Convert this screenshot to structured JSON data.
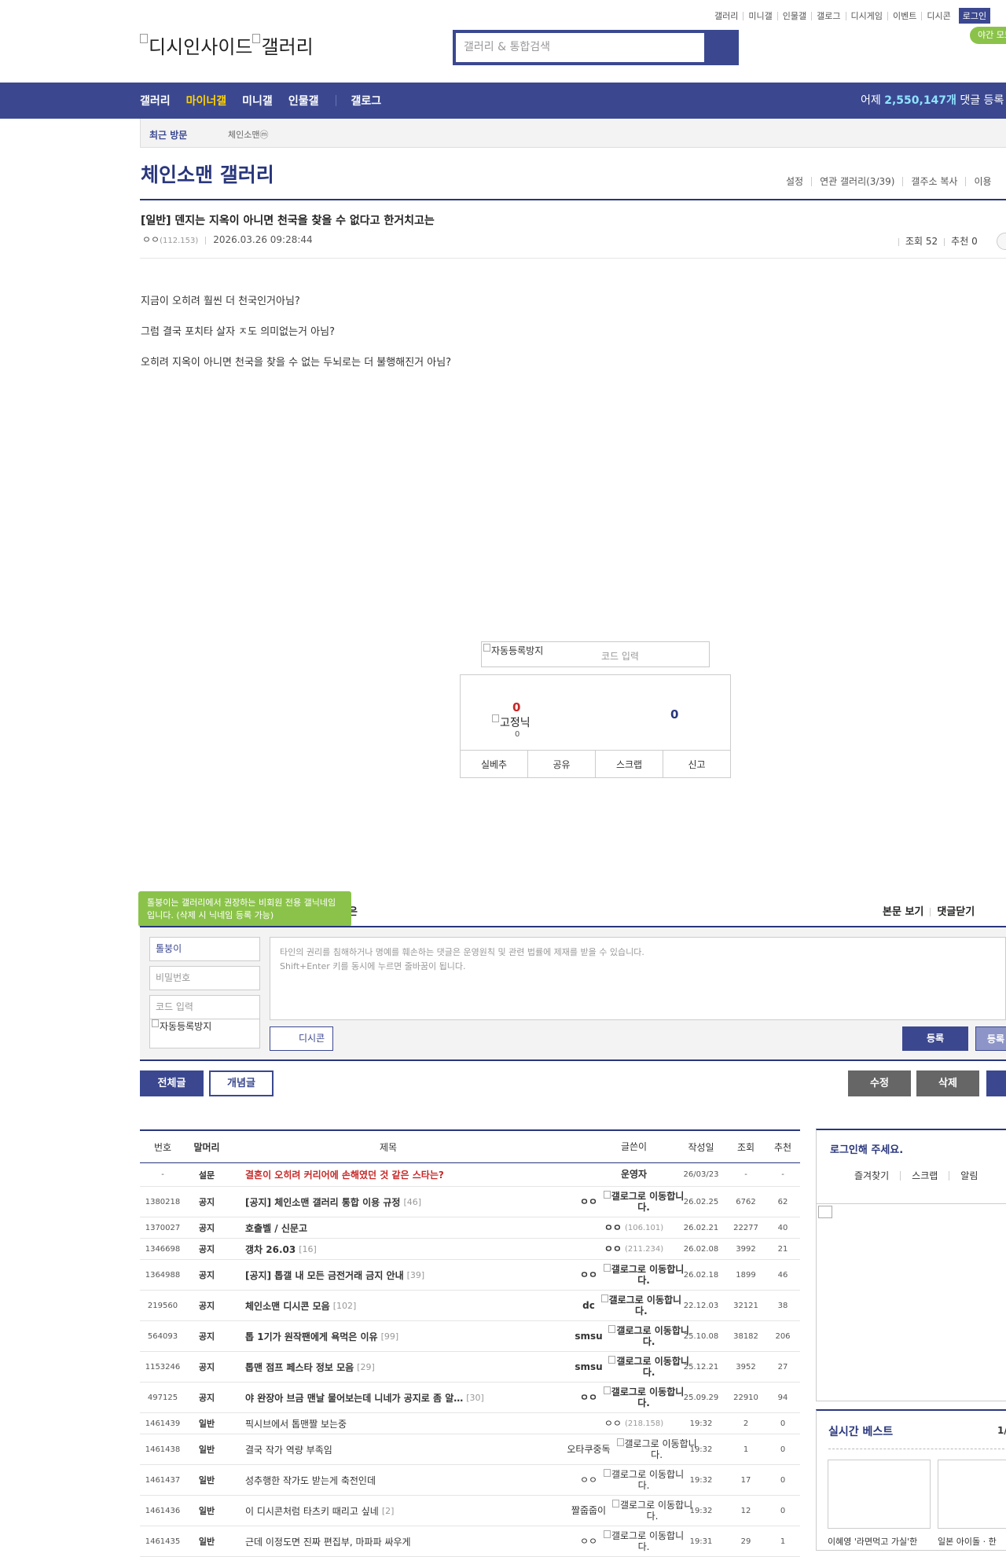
{
  "topnav": {
    "items": [
      "갤러리",
      "미니갤",
      "인물갤",
      "갤로그",
      "디시게임",
      "이벤트",
      "디시콘"
    ],
    "login": "로그인",
    "night": "야간 모드"
  },
  "logo": {
    "alt1": "디시인사이드",
    "alt2": "갤러리"
  },
  "search": {
    "placeholder": "갤러리 & 통합검색"
  },
  "nav": {
    "items": [
      "갤러리",
      "마이너갤",
      "미니갤",
      "인물갤"
    ],
    "gallog": "갤로그",
    "stat_prefix": "어제",
    "stat_value": "2,550,147개",
    "stat_suffix": "댓글 등록"
  },
  "recent": {
    "label": "최근 방문",
    "item": "체인소맨ⓜ"
  },
  "gallery": {
    "title": "체인소맨 갤러리",
    "menu": [
      "설정",
      "연관 갤러리(3/39)",
      "갤주소 복사",
      "이용"
    ]
  },
  "post": {
    "title": "[일반] 덴지는 지옥이 아니면 천국을 찾을 수 없다고 한거치고는",
    "author": "ㅇㅇ",
    "ip": "(112.153)",
    "date": "2026.03.26 09:28:44",
    "views": "조회 52",
    "recommend": "추천 0",
    "body": [
      "지금이 오히려 훨씬 더 천국인거아님?",
      "그럼 결국 포치타 살자 ㅈ도 의미없는거 아님?",
      "오히려 지옥이 아니면 천국을 찾을 수 없는 두뇌로는 더 불행해진거 아님?"
    ]
  },
  "captcha": {
    "img_alt": "자동등록방지",
    "placeholder": "코드 입력"
  },
  "vote": {
    "up": "0",
    "fixed_nick_alt": "고정닉",
    "fixed_count": "0",
    "down": "0",
    "buttons": [
      "실베추",
      "공유",
      "스크랩",
      "신고"
    ]
  },
  "comment": {
    "tooltip": "톨붕이는 갤러리에서 권장하는 비회원 전용 갤닉네임입니다. (삭제 시 닉네임 등록 가능)",
    "peek": "은",
    "options": [
      "본문 보기",
      "댓글닫기"
    ],
    "nick": "톨붕이",
    "password": "비밀번호",
    "code": "코드 입력",
    "captcha_alt": "자동등록방지",
    "placeholder1": "타인의 권리를 침해하거나 명예를 훼손하는 댓글은 운영원칙 및 관련 법률에 제재를 받을 수 있습니다.",
    "placeholder2": "Shift+Enter 키를 동시에 누르면 줄바꿈이 됩니다.",
    "dccon": "디시콘",
    "register": "등록",
    "register2": "등록"
  },
  "buttons": {
    "all": "전체글",
    "concept": "개념글",
    "edit": "수정",
    "delete": "삭제"
  },
  "list": {
    "headers": [
      "번호",
      "말머리",
      "제목",
      "글쓴이",
      "작성일",
      "조회",
      "추천"
    ],
    "rows": [
      {
        "no": "-",
        "head": "설문",
        "title": "결혼이 오히려 커리어에 손해였던 것 같은 스타는?",
        "count": "",
        "writer": "운영자",
        "ip": "",
        "img": "",
        "date": "26/03/23",
        "views": "-",
        "rec": "-",
        "type": "survey"
      },
      {
        "no": "1380218",
        "head": "공지",
        "title": "[공지] 체인소맨 갤러리 통합 이용 규정",
        "count": "[46]",
        "writer": "ㅇㅇ",
        "ip": "",
        "img": "갤로그로 이동합니다.",
        "date": "26.02.25",
        "views": "6762",
        "rec": "62",
        "type": "notice"
      },
      {
        "no": "1370027",
        "head": "공지",
        "title": "호출벨 / 신문고",
        "count": "",
        "writer": "ㅇㅇ",
        "ip": "(106.101)",
        "img": "",
        "date": "26.02.21",
        "views": "22277",
        "rec": "40",
        "type": "notice"
      },
      {
        "no": "1346698",
        "head": "공지",
        "title": "갱차 26.03",
        "count": "[16]",
        "writer": "ㅇㅇ",
        "ip": "(211.234)",
        "img": "",
        "date": "26.02.08",
        "views": "3992",
        "rec": "21",
        "type": "notice"
      },
      {
        "no": "1364988",
        "head": "공지",
        "title": "[공지] 톱갤 내 모든 금전거래 금지 안내",
        "count": "[39]",
        "writer": "ㅇㅇ",
        "ip": "",
        "img": "갤로그로 이동합니다.",
        "date": "26.02.18",
        "views": "1899",
        "rec": "46",
        "type": "notice"
      },
      {
        "no": "219560",
        "head": "공지",
        "title": "체인소맨 디시콘 모음",
        "count": "[102]",
        "writer": "dc",
        "ip": "",
        "img": "갤로그로 이동합니다.",
        "date": "22.12.03",
        "views": "32121",
        "rec": "38",
        "type": "notice"
      },
      {
        "no": "564093",
        "head": "공지",
        "title": "톱 1기가 원작팬에게 욕먹은 이유",
        "count": "[99]",
        "writer": "smsu",
        "ip": "",
        "img": "갤로그로 이동합니다.",
        "date": "25.10.08",
        "views": "38182",
        "rec": "206",
        "type": "notice"
      },
      {
        "no": "1153246",
        "head": "공지",
        "title": "톱맨 점프 페스타 정보 모음",
        "count": "[29]",
        "writer": "smsu",
        "ip": "",
        "img": "갤로그로 이동합니다.",
        "date": "25.12.21",
        "views": "3952",
        "rec": "27",
        "type": "notice"
      },
      {
        "no": "497125",
        "head": "공지",
        "title": "야 완장아 브금 맨날 물어보는데 니네가 공지로 좀 알…",
        "count": "[30]",
        "writer": "ㅇㅇ",
        "ip": "",
        "img": "갤로그로 이동합니다.",
        "date": "25.09.29",
        "views": "22910",
        "rec": "94",
        "type": "notice"
      },
      {
        "no": "1461439",
        "head": "일반",
        "title": "픽시브에서 톱맨짤 보는중",
        "count": "",
        "writer": "ㅇㅇ",
        "ip": "(218.158)",
        "img": "",
        "date": "19:32",
        "views": "2",
        "rec": "0",
        "type": "normal"
      },
      {
        "no": "1461438",
        "head": "일반",
        "title": "결국 작가 역량 부족임",
        "count": "",
        "writer": "오타쿠중독",
        "ip": "",
        "img": "갤로그로 이동합니다.",
        "date": "19:32",
        "views": "1",
        "rec": "0",
        "type": "normal"
      },
      {
        "no": "1461437",
        "head": "일반",
        "title": "성추행한 작가도 받는게 축전인데",
        "count": "",
        "writer": "ㅇㅇ",
        "ip": "",
        "img": "갤로그로 이동합니다.",
        "date": "19:32",
        "views": "17",
        "rec": "0",
        "type": "normal"
      },
      {
        "no": "1461436",
        "head": "일반",
        "title": "이 디시콘처럼 타츠키 때리고 싶네",
        "count": "[2]",
        "writer": "짤줍줍이",
        "ip": "",
        "img": "갤로그로 이동합니다.",
        "date": "19:32",
        "views": "12",
        "rec": "0",
        "type": "normal"
      },
      {
        "no": "1461435",
        "head": "일반",
        "title": "근데 이정도면 진짜 편집부, 마파파 싸우게",
        "count": "",
        "writer": "ㅇㅇ",
        "ip": "",
        "img": "갤로그로 이동합니다.",
        "date": "19:31",
        "views": "29",
        "rec": "1",
        "type": "normal"
      }
    ]
  },
  "side": {
    "login_title": "로그인해 주세요.",
    "login_menu": [
      "즐겨찾기",
      "스크랩",
      "알림"
    ],
    "best_title": "실시간 베스트",
    "best_page": "1/",
    "best_caps": [
      "이혜영 '라면먹고 가실'한",
      "일본 아이돌 · 한"
    ]
  }
}
